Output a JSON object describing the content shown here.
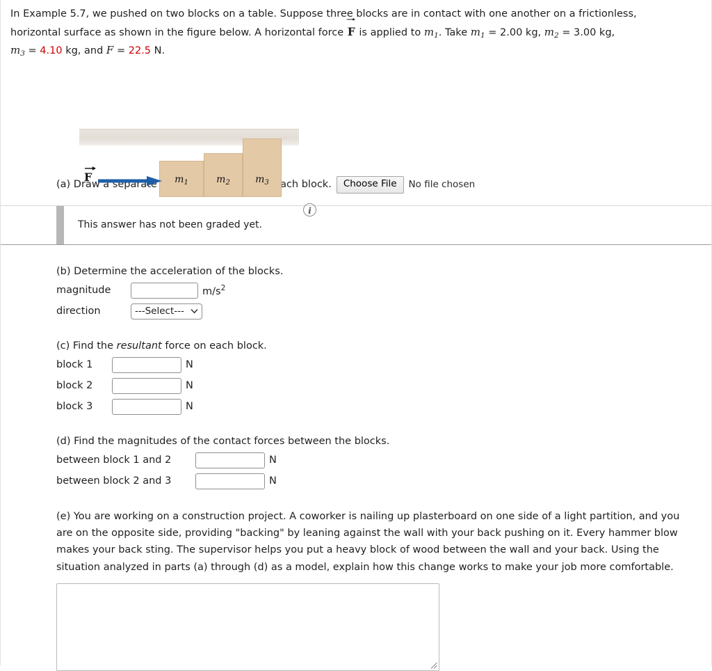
{
  "problem": {
    "line1_a": "In Example 5.7, we pushed on two blocks on a table. Suppose three blocks are in contact with one another on a frictionless,",
    "line2_a": "horizontal surface as shown in the figure below. A horizontal force ",
    "force_symbol": "F",
    "line2_b": " is applied to ",
    "m1_sym": "m",
    "m1_sub": "1",
    "line2_c": ". Take ",
    "m1_value": "= 2.00 kg,",
    "m2_sym": "m",
    "m2_sub": "2",
    "m2_value": "= 3.00 kg,",
    "m3_sym": "m",
    "m3_sub": "3",
    "m3_eq": "=",
    "m3_value": "4.10",
    "m3_unit": "kg, and",
    "F_sym": "F",
    "F_eq": "=",
    "F_value": "22.5",
    "F_unit": "N."
  },
  "figure": {
    "force_label": "F",
    "block1_label": "m",
    "block1_sub": "1",
    "block2_label": "m",
    "block2_sub": "2",
    "block3_label": "m",
    "block3_sub": "3",
    "info_icon": "i",
    "arrow_color": "#1f5fa8",
    "block_color": "#e4c9a7",
    "ground_color": "#e6e0d9"
  },
  "parts": {
    "a": {
      "prompt": "(a) Draw a separate free-body diagram for each block.",
      "choose_file_label": "Choose File",
      "no_file_text": "No file chosen",
      "notice_text": "This answer has not been graded yet."
    },
    "b": {
      "prompt": "(b) Determine the acceleration of the blocks.",
      "magnitude_label": "magnitude",
      "magnitude_value": "",
      "magnitude_unit": "m/s",
      "magnitude_unit_exp": "2",
      "direction_label": "direction",
      "direction_selected": "---Select---"
    },
    "c": {
      "prompt_before": "(c) Find the ",
      "prompt_italic": "resultant",
      "prompt_after": " force on each block.",
      "rows": [
        {
          "label": "block 1",
          "value": "",
          "unit": "N"
        },
        {
          "label": "block 2",
          "value": "",
          "unit": "N"
        },
        {
          "label": "block 3",
          "value": "",
          "unit": "N"
        }
      ]
    },
    "d": {
      "prompt": "(d) Find the magnitudes of the contact forces between the blocks.",
      "rows": [
        {
          "label": "between block 1 and 2",
          "value": "",
          "unit": "N"
        },
        {
          "label": "between block 2 and 3",
          "value": "",
          "unit": "N"
        }
      ]
    },
    "e": {
      "prompt": "(e) You are working on a construction project. A coworker is nailing up plasterboard on one side of a light partition, and you are on the opposite side, providing \"backing\" by leaning against the wall with your back pushing on it. Every hammer blow makes your back sting. The supervisor helps you put a heavy block of wood between the wall and your back. Using the situation analyzed in parts (a) through (d) as a model, explain how this change works to make your job more comfortable.",
      "answer_value": ""
    }
  }
}
